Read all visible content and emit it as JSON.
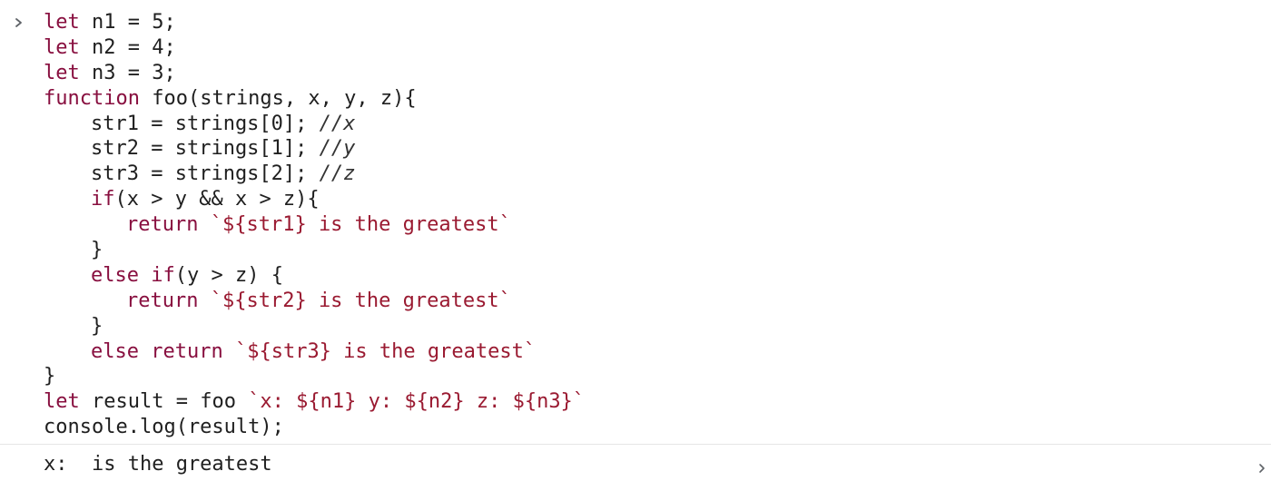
{
  "input": {
    "prompt_icon": "chevron-right-icon",
    "lines": {
      "l1": {
        "kw": "let",
        "rest": " n1 = 5;"
      },
      "l2": {
        "kw": "let",
        "rest": " n2 = 4;"
      },
      "l3": {
        "kw": "let",
        "rest": " n3 = 3;"
      },
      "l4": {
        "kw": "function",
        "rest": " foo(strings, x, y, z){"
      },
      "l5": {
        "code": "str1 = strings[0]; ",
        "comment": "//x"
      },
      "l6": {
        "code": "str2 = strings[1]; ",
        "comment": "//y"
      },
      "l7": {
        "code": "str3 = strings[2]; ",
        "comment": "//z"
      },
      "l8": {
        "kw": "if",
        "rest": "(x > y && x > z){"
      },
      "l9": {
        "kw": "return",
        "sp": " ",
        "tpl": "`${str1} is the greatest`"
      },
      "l10": {
        "text": "}"
      },
      "l11": {
        "kw1": "else",
        "sp": " ",
        "kw2": "if",
        "rest": "(y > z) {"
      },
      "l12": {
        "kw": "return",
        "sp": " ",
        "tpl": "`${str2} is the greatest`"
      },
      "l13": {
        "text": "}"
      },
      "l14": {
        "kw1": "else",
        "sp": " ",
        "kw2": "return",
        "sp2": " ",
        "tpl": "`${str3} is the greatest`"
      },
      "l15": {
        "text": "}"
      },
      "l16": {
        "kw": "let",
        "rest": " result = foo ",
        "tpl": "`x: ${n1} y: ${n2} z: ${n3}`"
      },
      "l17": {
        "text": "console.log(result);"
      }
    }
  },
  "output": {
    "text": "x:  is the greatest",
    "source_icon": "chevron-right-icon"
  },
  "colors": {
    "keyword": "#880f3f",
    "template_string": "#9a1a31",
    "text": "#1f1f1f",
    "divider": "#e6e6e6"
  }
}
